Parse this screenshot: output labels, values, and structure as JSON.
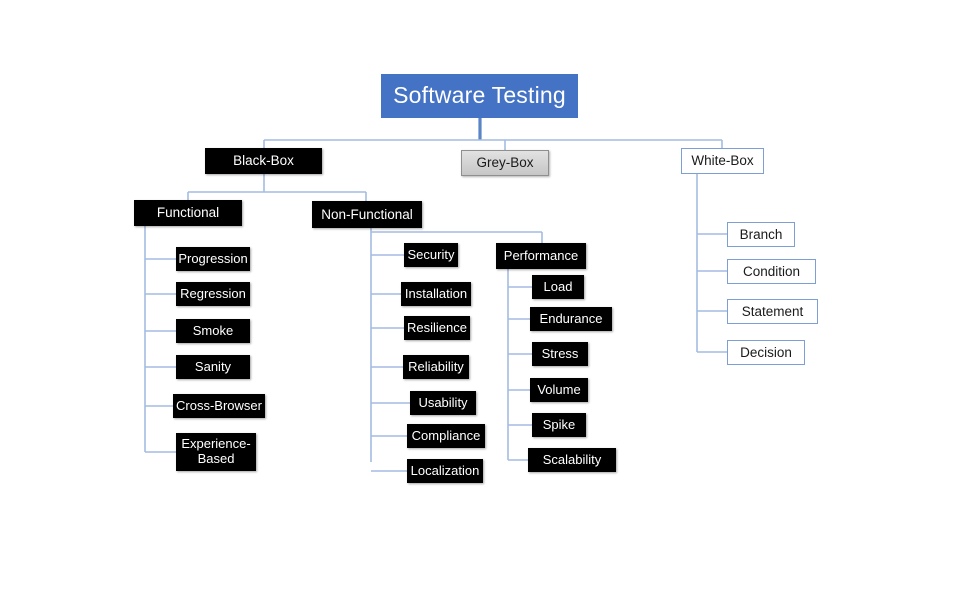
{
  "diagram": {
    "title": "Software Testing",
    "styles": {
      "root_fill": "#4472C4",
      "root_text": "#FFFFFF",
      "black_fill": "#000000",
      "black_text": "#FFFFFF",
      "grey_fill": "#D2D2D2",
      "grey_border": "#8F8F8F",
      "grey_text": "#1A1A1A",
      "white_fill": "#FFFFFF",
      "white_border": "#7E9FD4",
      "white_text": "#1A1A1A",
      "connector": "#A3BCE2",
      "root_connector": "#5B84C4"
    },
    "root": {
      "label": "Software Testing"
    },
    "level2": [
      {
        "label": "Black-Box",
        "style": "black"
      },
      {
        "label": "Grey-Box",
        "style": "grey"
      },
      {
        "label": "White-Box",
        "style": "white"
      }
    ],
    "black_box_children": [
      {
        "label": "Functional",
        "style": "black"
      },
      {
        "label": "Non-Functional",
        "style": "black"
      }
    ],
    "functional_children": [
      {
        "label": "Progression",
        "style": "black"
      },
      {
        "label": "Regression",
        "style": "black"
      },
      {
        "label": "Smoke",
        "style": "black"
      },
      {
        "label": "Sanity",
        "style": "black"
      },
      {
        "label": "Cross-Browser",
        "style": "black"
      },
      {
        "label": "Experience-\nBased",
        "style": "black"
      }
    ],
    "nonfunctional_children": [
      {
        "label": "Security",
        "style": "black"
      },
      {
        "label": "Installation",
        "style": "black"
      },
      {
        "label": "Resilience",
        "style": "black"
      },
      {
        "label": "Reliability",
        "style": "black"
      },
      {
        "label": "Usability",
        "style": "black"
      },
      {
        "label": "Compliance",
        "style": "black"
      },
      {
        "label": "Localization",
        "style": "black"
      }
    ],
    "performance": {
      "label": "Performance",
      "style": "black"
    },
    "performance_children": [
      {
        "label": "Load",
        "style": "black"
      },
      {
        "label": "Endurance",
        "style": "black"
      },
      {
        "label": "Stress",
        "style": "black"
      },
      {
        "label": "Volume",
        "style": "black"
      },
      {
        "label": "Spike",
        "style": "black"
      },
      {
        "label": "Scalability",
        "style": "black"
      }
    ],
    "whitebox_children": [
      {
        "label": "Branch",
        "style": "white"
      },
      {
        "label": "Condition",
        "style": "white"
      },
      {
        "label": "Statement",
        "style": "white"
      },
      {
        "label": "Decision",
        "style": "white"
      }
    ]
  }
}
